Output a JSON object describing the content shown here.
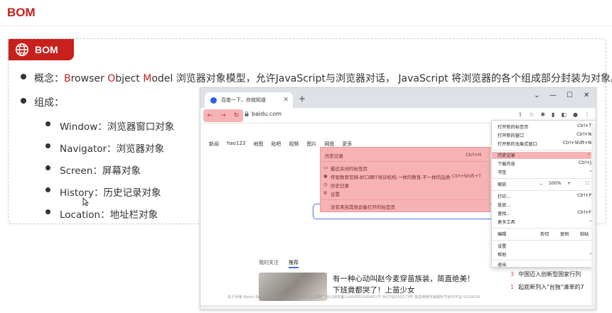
{
  "slide_title": "BOM",
  "badge_label": "BOM",
  "concept": {
    "prefix": "概念：",
    "b": "B",
    "rowser": "rowser ",
    "o": "O",
    "bject": "bject ",
    "m": "M",
    "odel": "odel",
    "rest": "  浏览器对象模型，允许JavaScript与浏览器对话， JavaScript 将浏览器的各个组成部分封装为对象。"
  },
  "composition_label": "组成：",
  "components": [
    "Window：浏览器窗口对象",
    "Navigator：浏览器对象",
    "Screen：屏幕对象",
    "History：历史记录对象",
    "Location：地址栏对象"
  ],
  "browser": {
    "tab_title": "百度一下，你就知道",
    "tab_close": "✕",
    "new_tab": "+",
    "url": "baidu.com",
    "win_controls": [
      "⌄",
      "—",
      "☐",
      "✕"
    ],
    "baidu_nav": [
      "新闻",
      "hao123",
      "地图",
      "贴吧",
      "视频",
      "图片",
      "网盘",
      "更多"
    ],
    "history_menu": {
      "history": "历史记录",
      "history_shortcut": "Ctrl+H",
      "recent_closed": "最近关闭的标签页",
      "item1": "传智教育官网-好口碑IT培训机构,一样的教育,不一样的品质",
      "item1_shortcut": "Ctrl+Shift+T",
      "item2": "历史记录",
      "item3": "设置",
      "other_devices": "没有来自其他设备打开的标签页"
    },
    "main_menu": {
      "new_tab": "打开新的标签页",
      "new_tab_sc": "Ctrl+T",
      "new_window": "打开新的窗口",
      "new_window_sc": "Ctrl+N",
      "incognito": "打开新的无痕式窗口",
      "incognito_sc": "Ctrl+Shift+N",
      "history": "历史记录",
      "downloads": "下载内容",
      "downloads_sc": "Ctrl+J",
      "bookmarks": "书签",
      "zoom": "缩放",
      "zoom_minus": "－",
      "zoom_value": "100%",
      "zoom_plus": "+",
      "print": "打印...",
      "print_sc": "Ctrl+P",
      "cast": "投放...",
      "find": "查找...",
      "find_sc": "Ctrl+F",
      "more_tools": "更多工具",
      "edit": "编辑",
      "cut": "剪切",
      "copy": "复制",
      "paste": "粘贴",
      "settings": "设置",
      "help": "帮助",
      "exit": "退出"
    },
    "feed_tab_follow": "我的关注",
    "feed_tab_recommend": "推荐",
    "feed_title": "有一种心动叫赵今麦穿苗族装，简直绝美！下班竟都哭了！上苗少女",
    "hot": [
      {
        "idx": "3",
        "text": "中国迈入创新型国家行列"
      },
      {
        "idx": "1",
        "text": "起底新列入\"台独\"清单的7"
      }
    ],
    "footer": "关于百度   About Baidu   使用百度前必读   帮助中心   企业推广   京公网安备11000002000001号   京ICP证030173号   信息网络传播视听节目许可证 0110516"
  }
}
